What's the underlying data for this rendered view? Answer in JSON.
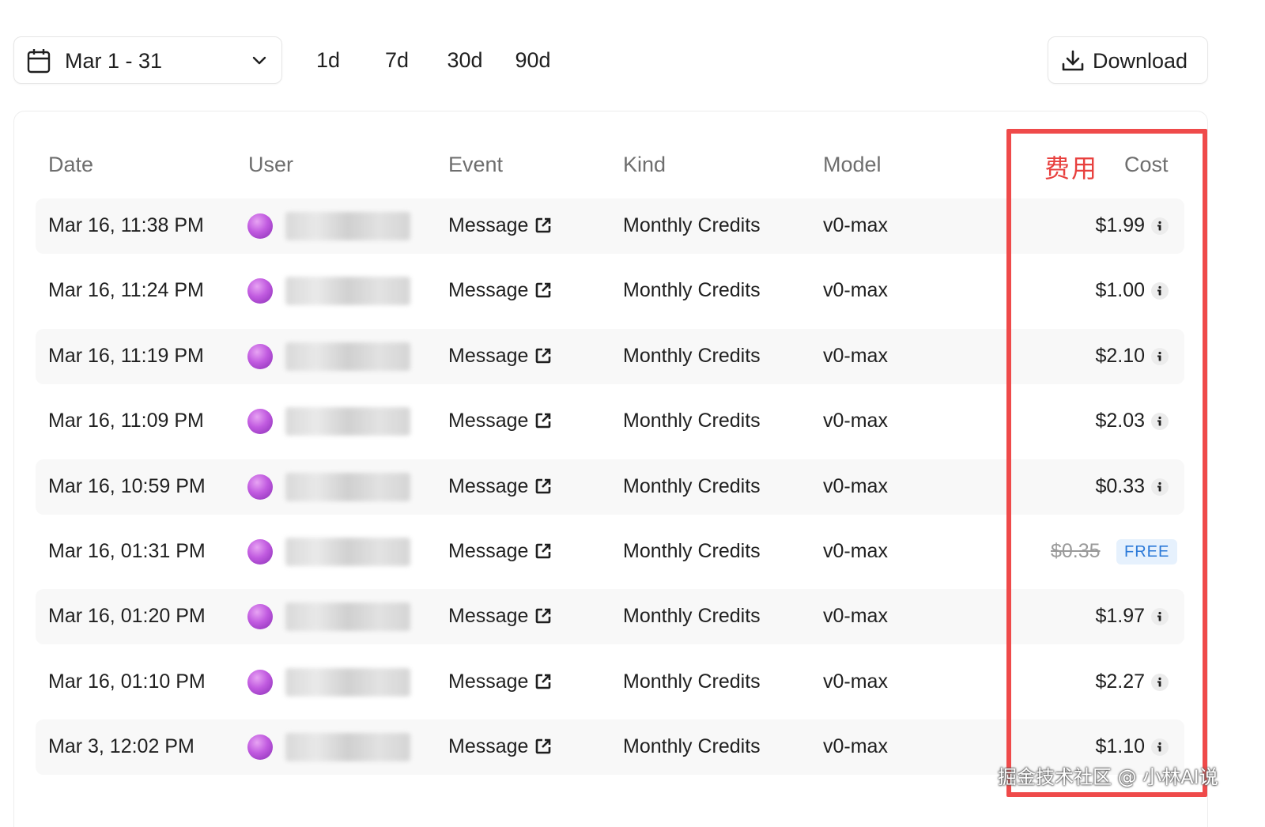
{
  "toolbar": {
    "date_range": "Mar 1 - 31",
    "quick_ranges": [
      "1d",
      "7d",
      "30d",
      "90d"
    ],
    "download_label": "Download"
  },
  "table": {
    "headers": {
      "date": "Date",
      "user": "User",
      "event": "Event",
      "kind": "Kind",
      "model": "Model",
      "cost": "Cost"
    },
    "rows": [
      {
        "date": "Mar 16, 11:38 PM",
        "event": "Message",
        "kind": "Monthly Credits",
        "model": "v0-max",
        "cost": "$1.99"
      },
      {
        "date": "Mar 16, 11:24 PM",
        "event": "Message",
        "kind": "Monthly Credits",
        "model": "v0-max",
        "cost": "$1.00"
      },
      {
        "date": "Mar 16, 11:19 PM",
        "event": "Message",
        "kind": "Monthly Credits",
        "model": "v0-max",
        "cost": "$2.10"
      },
      {
        "date": "Mar 16, 11:09 PM",
        "event": "Message",
        "kind": "Monthly Credits",
        "model": "v0-max",
        "cost": "$2.03"
      },
      {
        "date": "Mar 16, 10:59 PM",
        "event": "Message",
        "kind": "Monthly Credits",
        "model": "v0-max",
        "cost": "$0.33"
      },
      {
        "date": "Mar 16, 01:31 PM",
        "event": "Message",
        "kind": "Monthly Credits",
        "model": "v0-max",
        "cost": "$0.35",
        "badge": "FREE"
      },
      {
        "date": "Mar 16, 01:20 PM",
        "event": "Message",
        "kind": "Monthly Credits",
        "model": "v0-max",
        "cost": "$1.97"
      },
      {
        "date": "Mar 16, 01:10 PM",
        "event": "Message",
        "kind": "Monthly Credits",
        "model": "v0-max",
        "cost": "$2.27"
      },
      {
        "date": "Mar 3, 12:02 PM",
        "event": "Message",
        "kind": "Monthly Credits",
        "model": "v0-max",
        "cost": "$1.10"
      }
    ]
  },
  "annotation": {
    "label": "费用",
    "color": "#ef4a4a"
  },
  "watermark": "掘金技术社区 @ 小林AI说",
  "colors": {
    "avatar": "#c15be0",
    "free_badge_bg": "#e6f1fd",
    "free_badge_text": "#2b79d8"
  }
}
